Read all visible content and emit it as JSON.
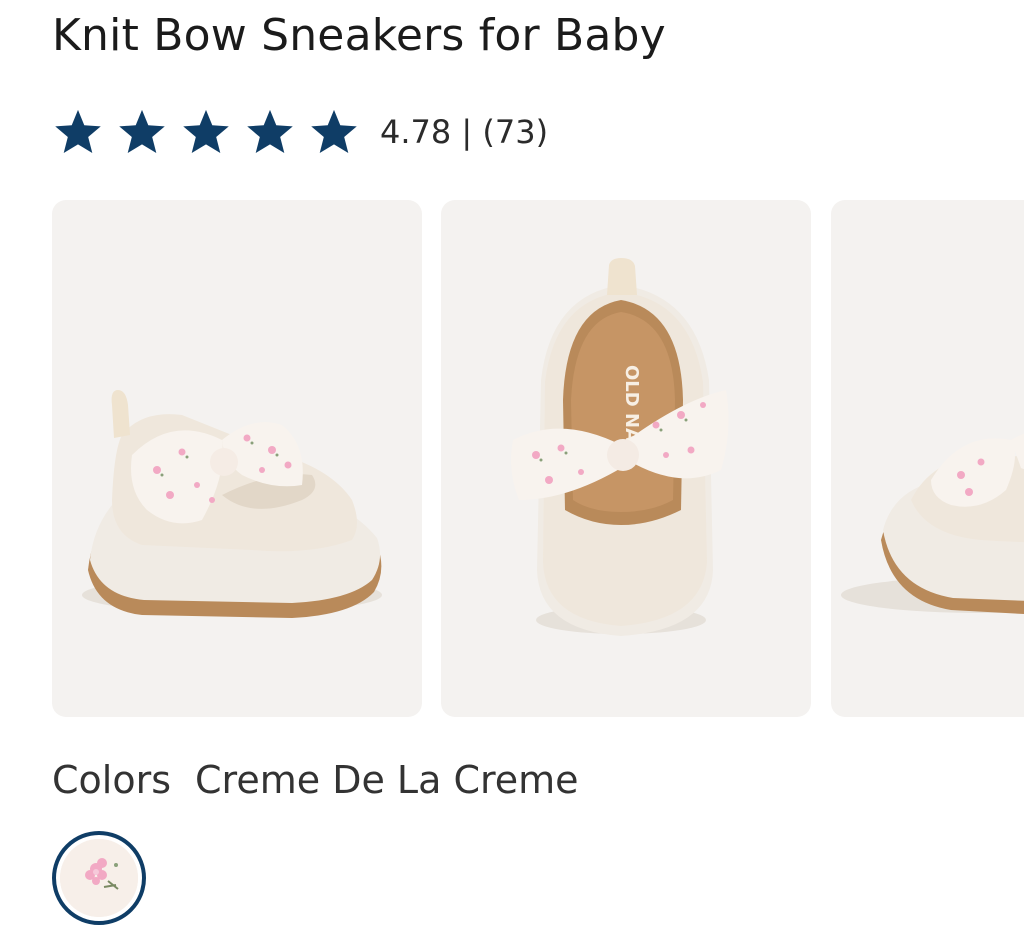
{
  "product": {
    "title": "Knit Bow Sneakers for Baby",
    "rating_value": 4.78,
    "rating_text": "4.78 | (73)",
    "stars_filled": 5,
    "star_color": "#0f3d66"
  },
  "gallery": {
    "background_color": "#f4f2f0",
    "shoe_color": "#efe7dc",
    "bow_pink": "#f2a9c4",
    "sole_color": "#b98a5a"
  },
  "colors": {
    "label": "Colors",
    "selected_name": "Creme De La Creme",
    "swatch_border_color": "#0f3d66",
    "swatch_icon": "floral-pattern-swatch"
  }
}
